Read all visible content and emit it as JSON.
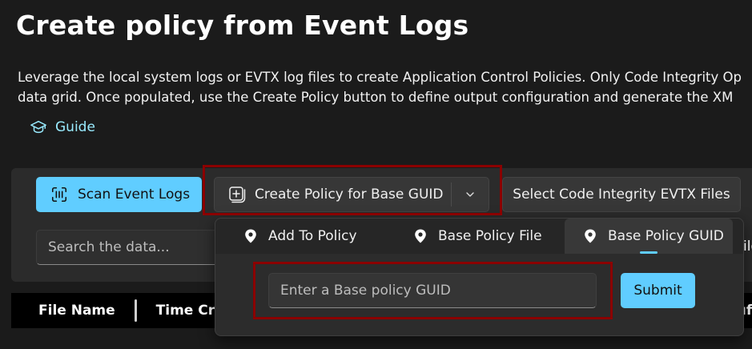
{
  "page": {
    "title": "Create policy from Event Logs",
    "description_line1": "Leverage the local system logs or EVTX log files to create Application Control Policies. Only Code Integrity Op",
    "description_line2": "data grid. Once populated, use the Create Policy button to define output configuration and generate the XM",
    "guide_label": "Guide"
  },
  "toolbar": {
    "scan_label": "Scan Event Logs",
    "create_policy_label": "Create Policy for Base GUID",
    "select_evtx_label": "Select Code Integrity EVTX Files",
    "search_placeholder": "Search the data..."
  },
  "grid": {
    "columns": [
      "File Name",
      "Time Cre",
      "ıf"
    ]
  },
  "flyout": {
    "tabs": [
      {
        "label": "Add To Policy",
        "selected": false
      },
      {
        "label": "Base Policy File",
        "selected": false
      },
      {
        "label": "Base Policy GUID",
        "selected": true
      }
    ],
    "overflow_text": "ile",
    "guid_placeholder": "Enter a Base policy GUID",
    "submit_label": "Submit"
  },
  "colors": {
    "accent": "#60cdff",
    "highlight": "#8b0000",
    "background": "#1b1b1b"
  }
}
